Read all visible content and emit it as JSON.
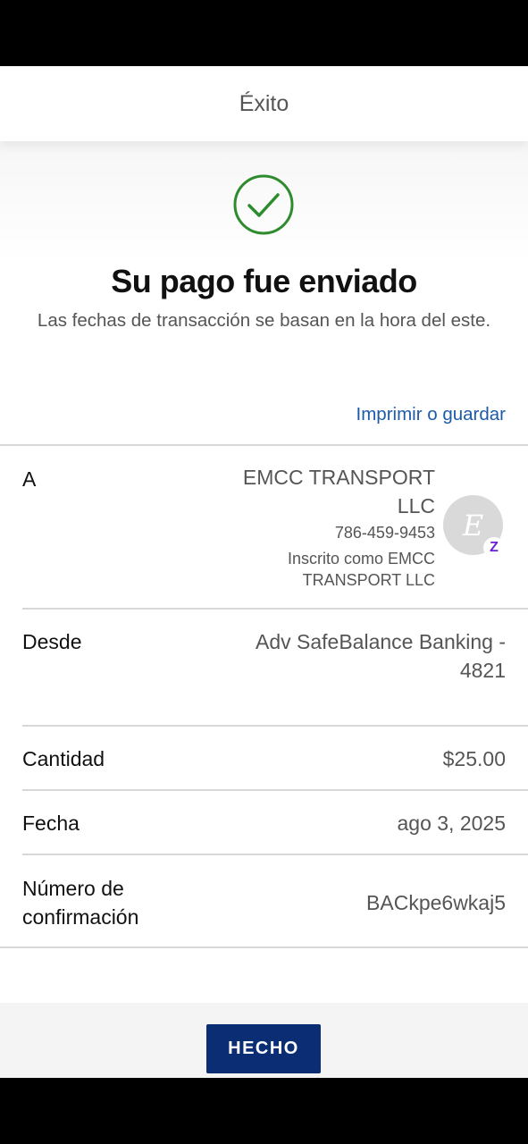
{
  "header": {
    "title": "Éxito"
  },
  "hero": {
    "title": "Su pago fue enviado",
    "subtitle": "Las fechas de transacción se basan en la hora del este.",
    "print_label": "Imprimir o guardar"
  },
  "details": {
    "to": {
      "label": "A",
      "name": "EMCC TRANSPORT LLC",
      "phone": "786-459-9453",
      "enrolled": "Inscrito como EMCC TRANSPORT LLC",
      "avatar_initial": "E",
      "badge": "Z"
    },
    "from": {
      "label": "Desde",
      "value": "Adv SafeBalance Banking - 4821"
    },
    "amount": {
      "label": "Cantidad",
      "value": "$25.00"
    },
    "date": {
      "label": "Fecha",
      "value": "ago 3, 2025"
    },
    "confirmation": {
      "label": "Número de confirmación",
      "value": "BACkpe6wkaj5"
    }
  },
  "footer": {
    "done_label": "HECHO"
  },
  "colors": {
    "accent": "#1d5aa8",
    "button": "#0b2d74",
    "success": "#2e8b2e",
    "zelle": "#6d1ed4"
  },
  "icons": {
    "success": "check-circle-icon"
  }
}
